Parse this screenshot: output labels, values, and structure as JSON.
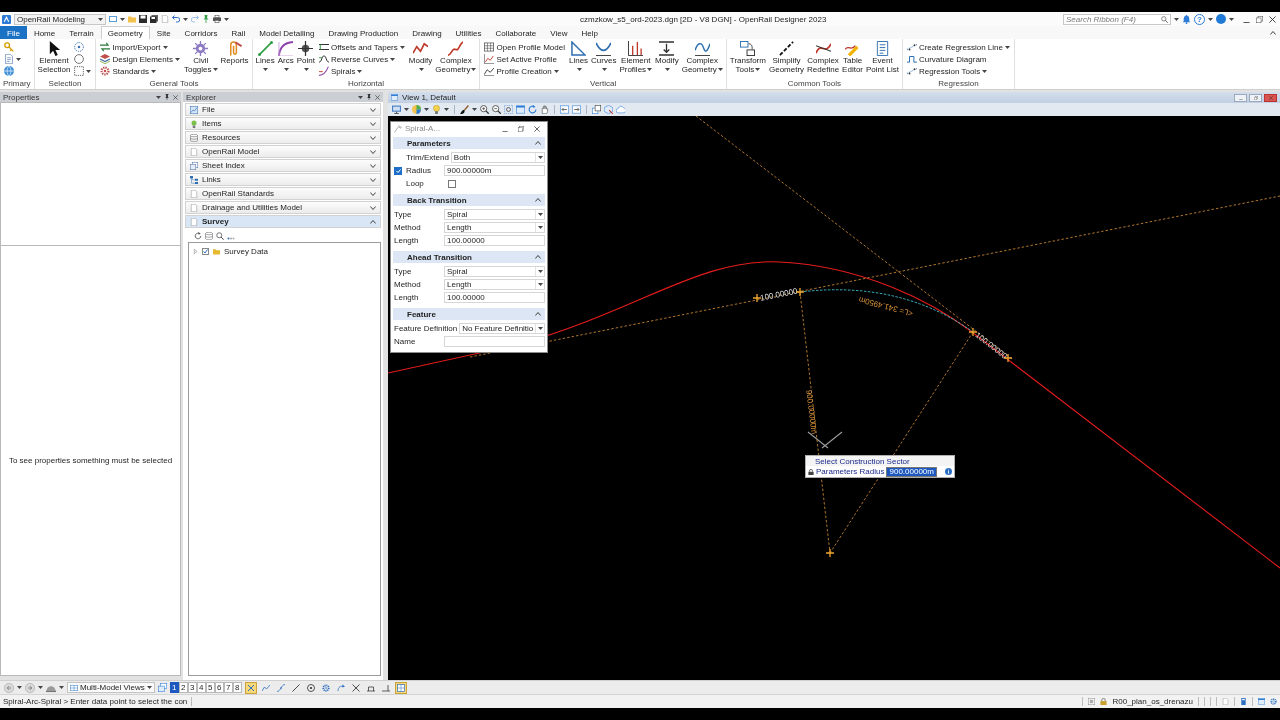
{
  "title_bar": {
    "workflow": "OpenRail Modeling",
    "title": "czmzkow_s5_ord-2023.dgn [2D - V8 DGN] - OpenRail Designer 2023",
    "search": {
      "placeholder": "Search Ribbon (F4)"
    },
    "help": "?"
  },
  "ribbon": {
    "tabs": [
      {
        "label": "File",
        "kind": "backstage",
        "selected": false
      },
      {
        "label": "Home",
        "kind": "tab",
        "selected": false
      },
      {
        "label": "Terrain",
        "kind": "tab",
        "selected": false
      },
      {
        "label": "Geometry",
        "kind": "tab",
        "selected": true
      },
      {
        "label": "Site",
        "kind": "tab",
        "selected": false
      },
      {
        "label": "Corridors",
        "kind": "tab",
        "selected": false
      },
      {
        "label": "Rail",
        "kind": "tab",
        "selected": false
      },
      {
        "label": "Model Detailing",
        "kind": "tab",
        "selected": false
      },
      {
        "label": "Drawing Production",
        "kind": "tab",
        "selected": false
      },
      {
        "label": "Drawing",
        "kind": "tab",
        "selected": false
      },
      {
        "label": "Utilities",
        "kind": "tab",
        "selected": false
      },
      {
        "label": "Collaborate",
        "kind": "tab",
        "selected": false
      },
      {
        "label": "View",
        "kind": "tab",
        "selected": false
      },
      {
        "label": "Help",
        "kind": "tab",
        "selected": false
      }
    ],
    "groups": [
      {
        "title": "Primary",
        "tools": [
          {
            "kind": "icon",
            "dropdown": false
          },
          {
            "kind": "icon",
            "dropdown": true
          },
          {
            "kind": "icon",
            "dropdown": false
          }
        ]
      },
      {
        "title": "Selection",
        "tools": [
          {
            "kind": "large",
            "label": "Element Selection",
            "dropdown": false
          },
          {
            "kind": "icon",
            "dropdown": false
          },
          {
            "kind": "icon",
            "dropdown": false
          },
          {
            "kind": "icon",
            "dropdown": true
          }
        ]
      },
      {
        "title": "General Tools",
        "tools": [
          {
            "kind": "small",
            "label": "Import/Export",
            "dropdown": true
          },
          {
            "kind": "small",
            "label": "Design Elements",
            "dropdown": true
          },
          {
            "kind": "small",
            "label": "Standards",
            "dropdown": true
          },
          {
            "kind": "large",
            "label": "Civil Toggles",
            "dropdown": true
          },
          {
            "kind": "large",
            "label": "Reports",
            "dropdown": false
          }
        ]
      },
      {
        "title": "Horizontal",
        "tools": [
          {
            "kind": "large",
            "label": "Lines",
            "dropdown": true
          },
          {
            "kind": "large",
            "label": "Arcs",
            "dropdown": true
          },
          {
            "kind": "large",
            "label": "Point",
            "dropdown": true
          },
          {
            "kind": "small",
            "label": "Offsets and Tapers",
            "dropdown": true
          },
          {
            "kind": "small",
            "label": "Reverse Curves",
            "dropdown": true
          },
          {
            "kind": "small",
            "label": "Spirals",
            "dropdown": true
          },
          {
            "kind": "large",
            "label": "Modify",
            "dropdown": true
          },
          {
            "kind": "large",
            "label": "Complex Geometry",
            "dropdown": true
          }
        ]
      },
      {
        "title": "Vertical",
        "tools": [
          {
            "kind": "small",
            "label": "Open Profile Model",
            "dropdown": false
          },
          {
            "kind": "small",
            "label": "Set Active Profile",
            "dropdown": false
          },
          {
            "kind": "small",
            "label": "Profile Creation",
            "dropdown": true
          },
          {
            "kind": "large",
            "label": "Lines",
            "dropdown": true
          },
          {
            "kind": "large",
            "label": "Curves",
            "dropdown": true
          },
          {
            "kind": "large",
            "label": "Element Profiles",
            "dropdown": true
          },
          {
            "kind": "large",
            "label": "Modify",
            "dropdown": true
          },
          {
            "kind": "large",
            "label": "Complex Geometry",
            "dropdown": true
          }
        ]
      },
      {
        "title": "Common Tools",
        "tools": [
          {
            "kind": "large",
            "label": "Transform Tools",
            "dropdown": true
          },
          {
            "kind": "large",
            "label": "Simplify Geometry",
            "dropdown": false
          },
          {
            "kind": "large",
            "label": "Complex Redefine",
            "dropdown": false
          },
          {
            "kind": "large",
            "label": "Table Editor",
            "dropdown": false
          },
          {
            "kind": "large",
            "label": "Event Point List",
            "dropdown": false
          }
        ]
      },
      {
        "title": "Regression",
        "tools": [
          {
            "kind": "small",
            "label": "Create Regression Line",
            "dropdown": true
          },
          {
            "kind": "small",
            "label": "Curvature Diagram",
            "dropdown": false
          },
          {
            "kind": "small",
            "label": "Regression Tools",
            "dropdown": true
          }
        ]
      }
    ]
  },
  "properties": {
    "title": "Properties",
    "message": "To see properties something must be selected"
  },
  "explorer": {
    "title": "Explorer",
    "sections": [
      {
        "label": "File",
        "expanded": false
      },
      {
        "label": "Items",
        "expanded": false
      },
      {
        "label": "Resources",
        "expanded": false
      },
      {
        "label": "OpenRail Model",
        "expanded": false
      },
      {
        "label": "Sheet Index",
        "expanded": false
      },
      {
        "label": "Links",
        "expanded": false
      },
      {
        "label": "OpenRail Standards",
        "expanded": false
      },
      {
        "label": "Drainage and Utilities Model",
        "expanded": false
      },
      {
        "label": "Survey",
        "expanded": true,
        "items": [
          {
            "label": "Survey Data",
            "checked": true,
            "expanded": false
          }
        ]
      }
    ]
  },
  "view": {
    "title": "View 1, Default",
    "canvas": {
      "labels": [
        "100.00000",
        "<L= 341.4950m",
        "100.00000",
        "900.00000m"
      ]
    },
    "dialog": {
      "title": "Spiral-A...",
      "sections": [
        {
          "title": "Parameters",
          "expanded": true,
          "rows": [
            {
              "kind": "dropdown",
              "label": "Trim/Extend",
              "value": "Both"
            },
            {
              "kind": "check_field",
              "label": "Radius",
              "checked": true,
              "value": "900.00000m"
            },
            {
              "kind": "checkbox",
              "label": "Loop",
              "checked": false
            }
          ]
        },
        {
          "title": "Back Transition",
          "expanded": true,
          "rows": [
            {
              "kind": "dropdown",
              "label": "Type",
              "value": "Spiral"
            },
            {
              "kind": "dropdown",
              "label": "Method",
              "value": "Length"
            },
            {
              "kind": "text",
              "label": "Length",
              "value": "100.00000"
            }
          ]
        },
        {
          "title": "Ahead Transition",
          "expanded": true,
          "rows": [
            {
              "kind": "dropdown",
              "label": "Type",
              "value": "Spiral"
            },
            {
              "kind": "dropdown",
              "label": "Method",
              "value": "Length"
            },
            {
              "kind": "text",
              "label": "Length",
              "value": "100.00000"
            }
          ]
        },
        {
          "title": "Feature",
          "expanded": true,
          "rows": [
            {
              "kind": "dropdown",
              "label": "Feature Definition",
              "value": "No Feature Definitio"
            },
            {
              "kind": "text",
              "label": "Name"
            }
          ]
        }
      ]
    },
    "cursor_prompt": {
      "prompt": "Select Construction Sector",
      "label": "Parameters Radius",
      "value": "900.00000m",
      "value_selected": true
    }
  },
  "view_bar": {
    "view_group": "Multi-Model Views",
    "views": [
      {
        "label": "1",
        "selected": true
      },
      {
        "label": "2",
        "selected": false
      },
      {
        "label": "3",
        "selected": false
      },
      {
        "label": "4",
        "selected": false
      },
      {
        "label": "5",
        "selected": false
      },
      {
        "label": "6",
        "selected": false
      },
      {
        "label": "7",
        "selected": false
      },
      {
        "label": "8",
        "selected": false
      }
    ],
    "tools": [
      {
        "active": true
      },
      {
        "active": false
      },
      {
        "active": false
      },
      {
        "active": false
      },
      {
        "active": false
      },
      {
        "active": false
      },
      {
        "active": false
      },
      {
        "active": false
      },
      {
        "active": false
      },
      {
        "active": false
      },
      {
        "active": true
      }
    ]
  },
  "status_bar": {
    "prompt": "Spiral-Arc-Spiral > Enter data point to select the con",
    "model": "R00_plan_os_drenazu"
  }
}
